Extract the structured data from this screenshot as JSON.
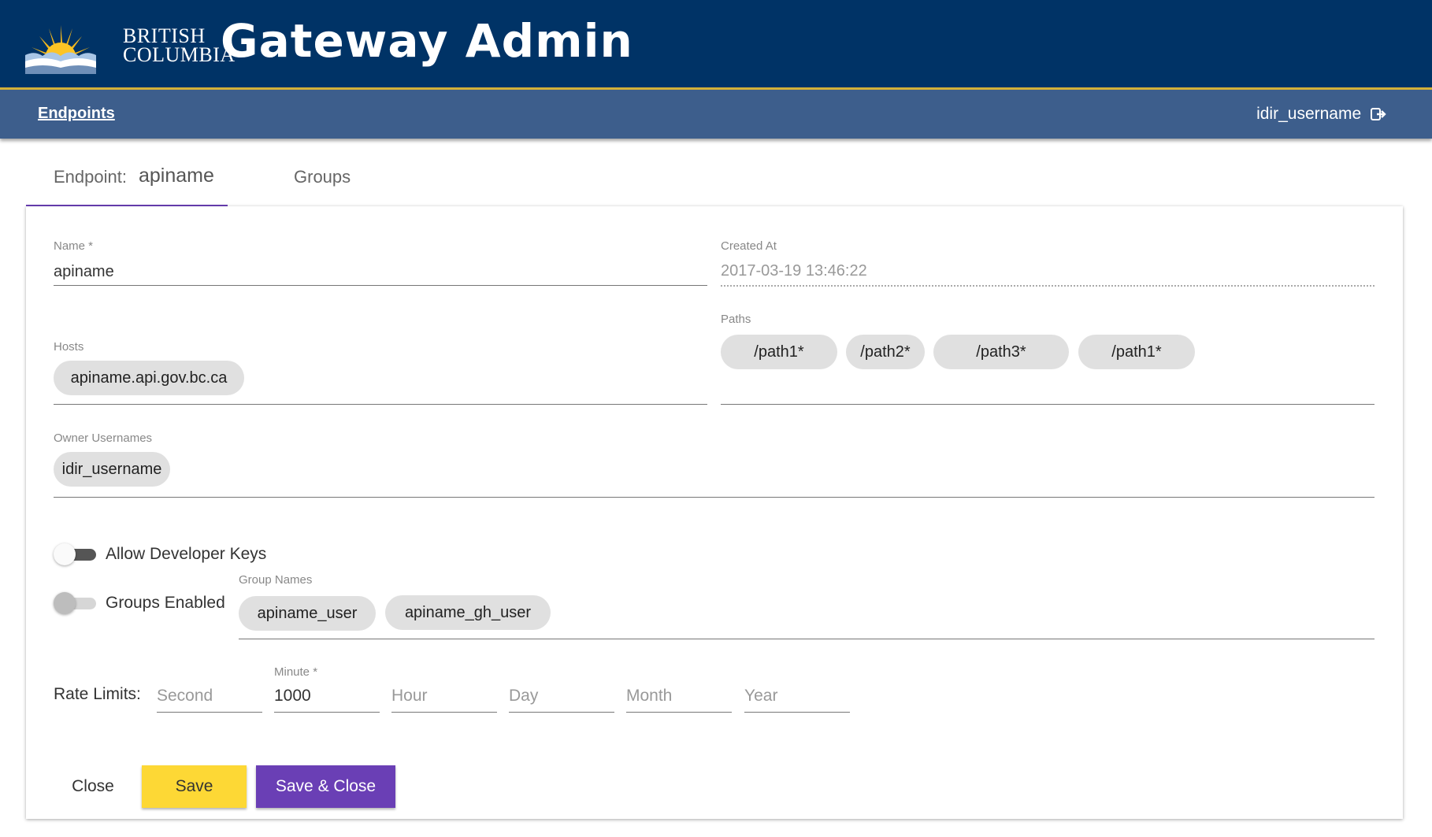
{
  "header": {
    "logo_line1": "BRITISH",
    "logo_line2": "COLUMBIA",
    "title": "Gateway Admin"
  },
  "nav": {
    "endpoints_link": "Endpoints",
    "username": "idir_username",
    "logout_icon": "logout-icon"
  },
  "tabs": {
    "endpoint_label": "Endpoint:",
    "endpoint_name": "apiname",
    "groups_label": "Groups"
  },
  "form": {
    "name_label": "Name *",
    "name_value": "apiname",
    "created_label": "Created At",
    "created_value": "2017-03-19 13:46:22",
    "hosts_label": "Hosts",
    "hosts": [
      "apiname.api.gov.bc.ca"
    ],
    "paths_label": "Paths",
    "paths": [
      "/path1*",
      "/path2*",
      "/path3*",
      "/path1*"
    ],
    "owners_label": "Owner Usernames",
    "owners": [
      "idir_username"
    ],
    "allow_dev_keys_label": "Allow Developer Keys",
    "allow_dev_keys_on": false,
    "groups_enabled_label": "Groups Enabled",
    "groups_enabled_on": false,
    "group_names_label": "Group Names",
    "group_names": [
      "apiname_user",
      "apiname_gh_user"
    ]
  },
  "rate_limits": {
    "label": "Rate Limits:",
    "second_placeholder": "Second",
    "minute_label": "Minute *",
    "minute_value": "1000",
    "hour_placeholder": "Hour",
    "day_placeholder": "Day",
    "month_placeholder": "Month",
    "year_placeholder": "Year"
  },
  "actions": {
    "close_label": "Close",
    "save_label": "Save",
    "save_close_label": "Save & Close"
  },
  "colors": {
    "header_bg": "#003366",
    "nav_bg": "#3d5e8c",
    "accent_purple": "#6a3fb5",
    "save_yellow": "#fdd835"
  }
}
